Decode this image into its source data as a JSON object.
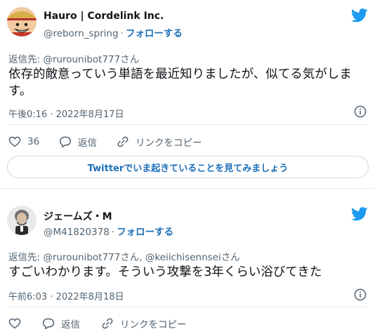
{
  "colors": {
    "accent": "#1d9bf0",
    "link": "#1d6fb8",
    "muted": "#536471",
    "text": "#0f1419"
  },
  "tweets": [
    {
      "display_name": "Hauro | Cordelink Inc.",
      "handle": "@reborn_spring",
      "separator": "·",
      "follow_label": "フォローする",
      "reply_to_prefix": "返信先:",
      "reply_to": "@rurounibot777さん",
      "body": "依存的敵意っていう単語を最近知りましたが、似てる気がします。",
      "timestamp": "午後0:16 · 2022年8月17日",
      "like_count": "36",
      "reply_label": "返信",
      "copy_link_label": "リンクをコピー",
      "cta_label": "Twitterでいま起きていることを見てみましょう"
    },
    {
      "display_name": "ジェームズ・M",
      "handle": "@M41820378",
      "separator": "·",
      "follow_label": "フォローする",
      "reply_to_prefix": "返信先:",
      "reply_to": "@rurounibot777さん, @keiichisennseiさん",
      "body": "すごいわかります。そういう攻撃を3年くらい浴びてきた",
      "timestamp": "午前6:03 · 2022年8月18日",
      "reply_label": "返信",
      "copy_link_label": "リンクをコピー"
    }
  ],
  "icons": [
    "avatar-anime",
    "avatar-bearded-man",
    "twitter-bird-icon",
    "info-icon",
    "heart-icon",
    "reply-icon",
    "link-icon"
  ]
}
